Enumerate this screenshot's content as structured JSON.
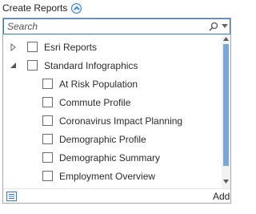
{
  "header": {
    "title": "Create Reports",
    "collapse_icon": "chevron-up-circle-icon"
  },
  "search": {
    "placeholder": "Search",
    "value": "",
    "icon": "search-icon",
    "dropdown_icon": "caret-down-icon"
  },
  "tree": {
    "items": [
      {
        "label": "Esri Reports",
        "expanded": false,
        "checked": false
      },
      {
        "label": "Standard Infographics",
        "expanded": true,
        "checked": false
      },
      {
        "label": "At Risk Population",
        "checked": false
      },
      {
        "label": "Commute Profile",
        "checked": false
      },
      {
        "label": "Coronavirus Impact Planning",
        "checked": false
      },
      {
        "label": "Demographic Profile",
        "checked": false
      },
      {
        "label": "Demographic Summary",
        "checked": false
      },
      {
        "label": "Employment Overview",
        "checked": false
      }
    ]
  },
  "footer": {
    "list_icon": "list-icon",
    "add_label": "Add"
  },
  "colors": {
    "accent": "#2b7cd3",
    "scroll_thumb": "#7aa7d9",
    "border": "#a8a8a8"
  }
}
